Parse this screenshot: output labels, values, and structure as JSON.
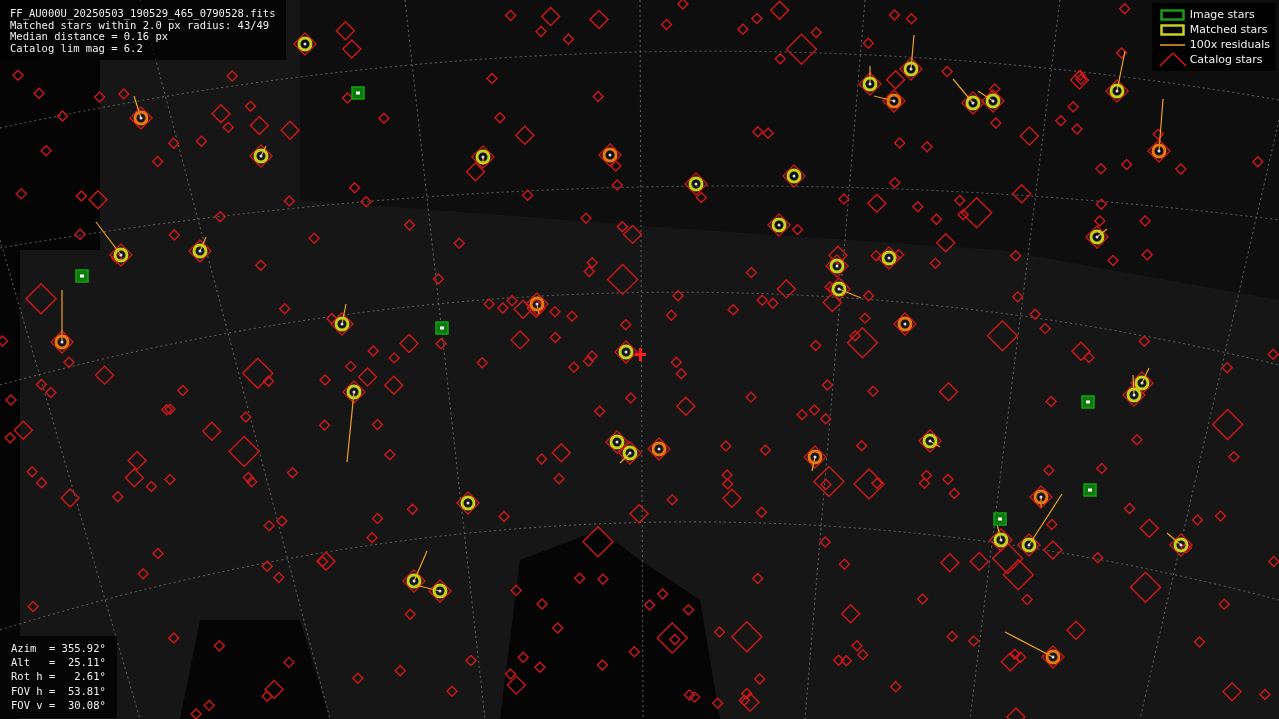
{
  "header_lines": [
    "FF_AU000U_20250503_190529_465_0790528.fits",
    "Matched stars within 2.0 px radius: 43/49",
    "Median distance = 0.16 px",
    "Catalog lim mag = 6.2"
  ],
  "legend": [
    {
      "kind": "image",
      "label": "Image stars"
    },
    {
      "kind": "matched",
      "label": "Matched stars"
    },
    {
      "kind": "residual",
      "label": "100x residuals"
    },
    {
      "kind": "catalog",
      "label": "Catalog stars"
    }
  ],
  "pointing": [
    {
      "label": "Azim  ",
      "value": "= 355.92°"
    },
    {
      "label": "Alt   ",
      "value": "=  25.11°"
    },
    {
      "label": "Rot h ",
      "value": "=   2.61°"
    },
    {
      "label": "FOV h ",
      "value": "=  53.81°"
    },
    {
      "label": "FOV v ",
      "value": "=  30.08°"
    }
  ]
}
